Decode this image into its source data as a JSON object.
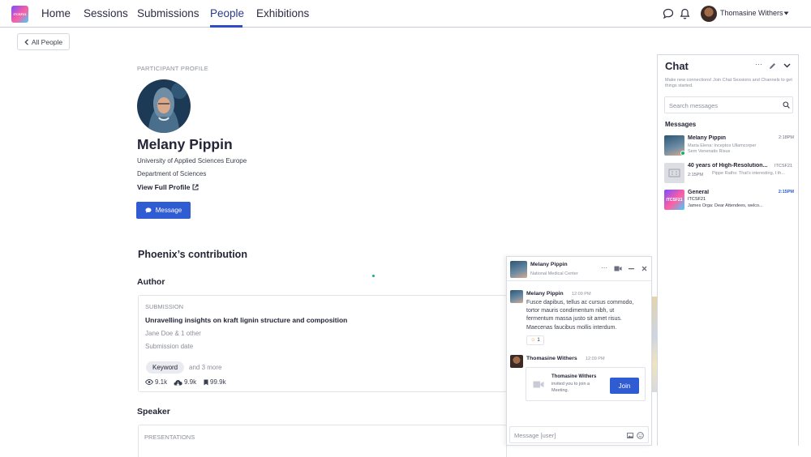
{
  "nav": {
    "logo_text": "ITCSF21",
    "links": [
      "Home",
      "Sessions",
      "Submissions",
      "People",
      "Exhibitions"
    ],
    "active": "People",
    "user_name": "Thomasine Withers",
    "accent": "#2f4bc6"
  },
  "back_button": "All People",
  "profile": {
    "section_label": "PARTICIPANT PROFILE",
    "name": "Melany Pippin",
    "affiliation": "University of Applied Sciences Europe",
    "department": "Department of Sciences",
    "view_profile": "View Full Profile",
    "message_button": "Message"
  },
  "contribution": {
    "heading": "Phoenix’s contribution",
    "author_heading": "Author",
    "submission": {
      "label": "SUBMISSION",
      "title": "Unravelling insights on kraft lignin structure and composition",
      "authors": "Jane Doe & 1 other",
      "date_label": "Submission date",
      "keyword": "Keyword",
      "more": "and 3 more",
      "views": "9.1k",
      "downloads": "9.9k",
      "bookmarks": "99.9k"
    },
    "speaker_heading": "Speaker",
    "presentations_label": "PRESENTATIONS"
  },
  "chat_panel": {
    "title": "Chat",
    "description": "Make new connections! Join Chat Sessions and Channels to get things started.",
    "search_placeholder": "Search messages",
    "messages_heading": "Messages",
    "conversations": [
      {
        "name": "Melany Pippin",
        "time": "2:18PM",
        "line1": "Maria Elena: Inceptos Ullamcorper",
        "line2": "Sem Venenatis Risus"
      },
      {
        "name": "40 years of High-Resolution...",
        "tag": "ITCSF21",
        "time": "2:15PM",
        "line1": "Pippe Raths: That's interesting, I th..."
      },
      {
        "name": "General",
        "time": "2:15PM",
        "line1": "ITCSF21",
        "line2": "James Orga: Dear Attendees, welco..."
      }
    ]
  },
  "chat_popup": {
    "name": "Melany Pippin",
    "org": "National Medical Center",
    "msg1": {
      "sender": "Melany Pippin",
      "time": "12:09 PM",
      "lines": [
        "Fusce dapibus, tellus ac cursus commodo,",
        "tortor mauris condimentum nibh, ut",
        "fermentum massa justo sit amet risus.",
        "Maecenas faucibus mollis interdum."
      ],
      "reaction_count": "1"
    },
    "msg2": {
      "sender": "Thomasine Withers",
      "time": "12:09 PM",
      "invite_name": "Thomasine Withers",
      "invite_line1": "invited you to join a",
      "invite_line2": "Meeting.",
      "join": "Join"
    },
    "input_placeholder": "Message [user]"
  }
}
